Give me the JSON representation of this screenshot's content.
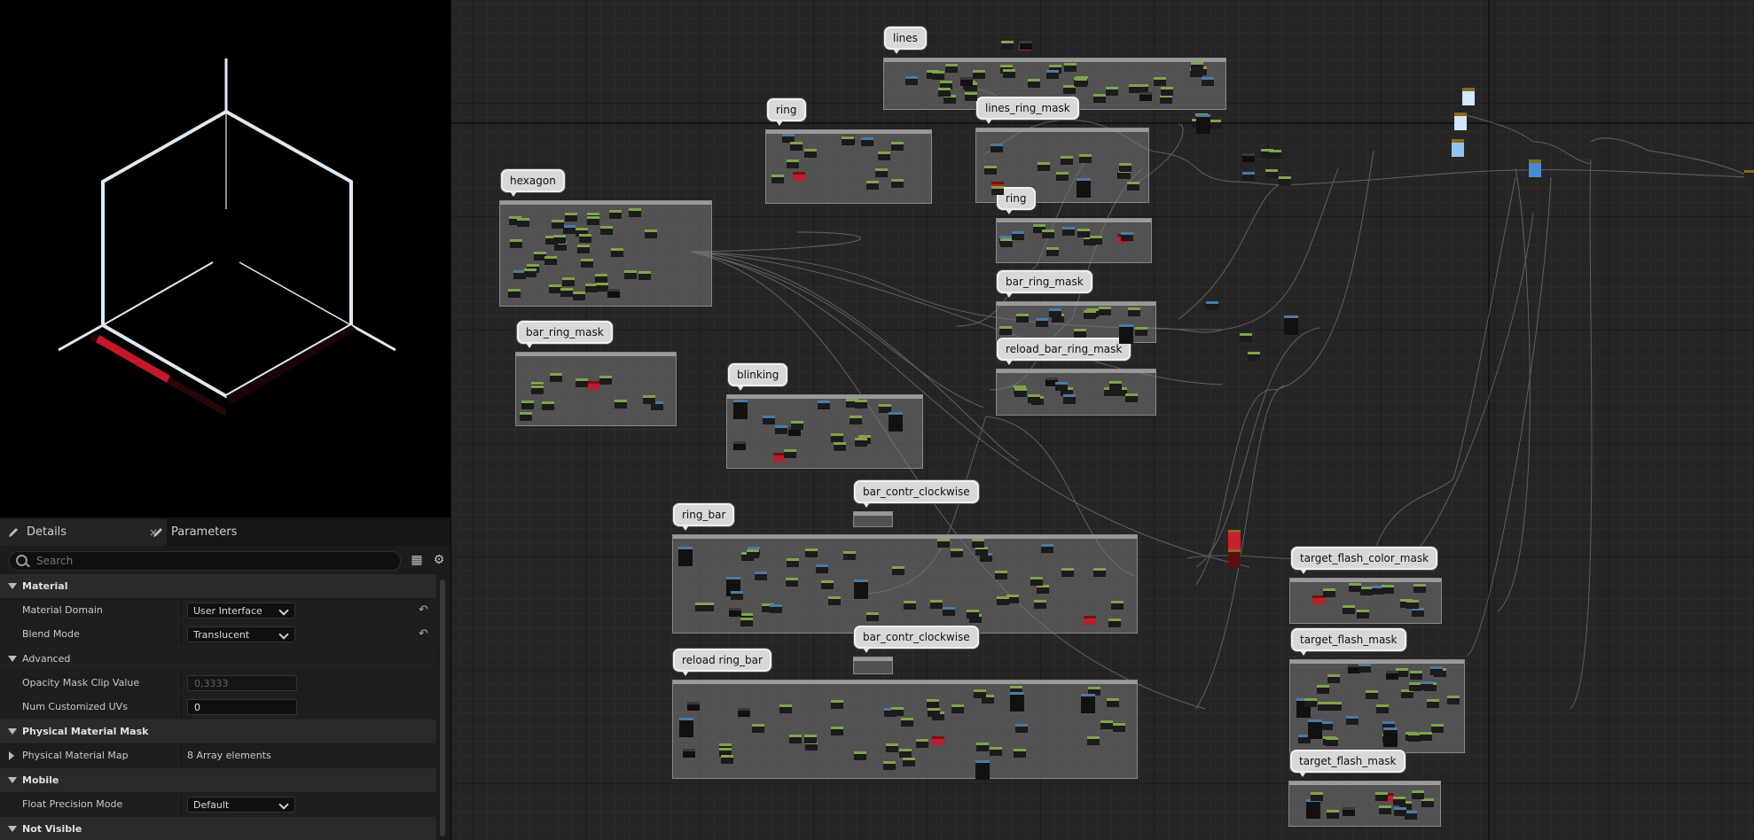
{
  "details_panel": {
    "tabs": [
      {
        "label": "Details",
        "close": "×"
      },
      {
        "label": "Parameters"
      }
    ],
    "search_placeholder": "Search",
    "toolbar_icons": [
      "table-view-icon",
      "settings-gear-icon"
    ],
    "sections": {
      "material": {
        "title": "Material",
        "material_domain": {
          "label": "Material Domain",
          "value": "User Interface"
        },
        "blend_mode": {
          "label": "Blend Mode",
          "value": "Translucent"
        }
      },
      "advanced": {
        "title": "Advanced",
        "opacity_clip": {
          "label": "Opacity Mask Clip Value",
          "value": "0,3333"
        },
        "num_uvs": {
          "label": "Num Customized UVs",
          "value": "0"
        }
      },
      "physical_mask": {
        "title": "Physical Material Mask",
        "map": {
          "label": "Physical Material Map",
          "value": "8 Array elements"
        }
      },
      "mobile": {
        "title": "Mobile",
        "float_precision": {
          "label": "Float Precision Mode",
          "value": "Default"
        }
      },
      "not_visible": {
        "title": "Not Visible"
      }
    }
  },
  "graph": {
    "comments": [
      {
        "id": "lines",
        "label": "lines"
      },
      {
        "id": "ring-1",
        "label": "ring"
      },
      {
        "id": "lines-ring-mask",
        "label": "lines_ring_mask"
      },
      {
        "id": "hexagon",
        "label": "hexagon"
      },
      {
        "id": "ring-2",
        "label": "ring"
      },
      {
        "id": "bar-ring-mask-right",
        "label": "bar_ring_mask"
      },
      {
        "id": "reload-bar-ring-mask",
        "label": "reload_bar_ring_mask"
      },
      {
        "id": "bar-ring-mask-left",
        "label": "bar_ring_mask"
      },
      {
        "id": "blinking",
        "label": "blinking"
      },
      {
        "id": "bar-contr-clockwise-1",
        "label": "bar_contr_clockwise"
      },
      {
        "id": "ring-bar",
        "label": "ring_bar"
      },
      {
        "id": "bar-contr-clockwise-2",
        "label": "bar_contr_clockwise"
      },
      {
        "id": "reload-ring-bar",
        "label": "reload ring_bar"
      },
      {
        "id": "target-flash-color-mask",
        "label": "target_flash_color_mask"
      },
      {
        "id": "target-flash-mask-1",
        "label": "target_flash_mask"
      },
      {
        "id": "target-flash-mask-2",
        "label": "target_flash_mask"
      }
    ]
  },
  "colors": {
    "graph_bg": "#252525",
    "node_green": "#7fa34b",
    "node_blue": "#4a7aa8",
    "accent_red": "#b8202e",
    "preview_line": "#dfe9f2"
  }
}
